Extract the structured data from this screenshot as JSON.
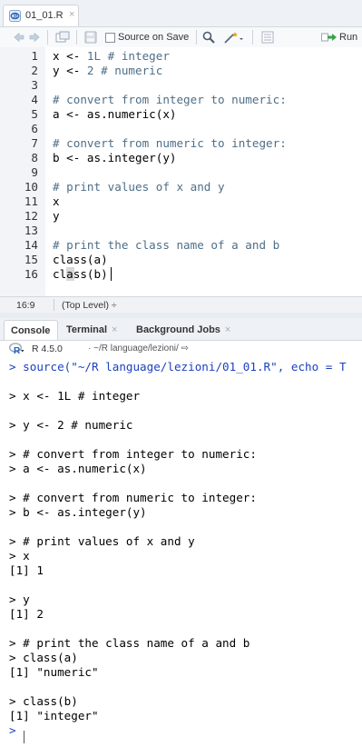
{
  "editor": {
    "tab_label": "01_01.R",
    "tab_close": "×",
    "source_on_save_label": "Source on Save",
    "run_label": "Run",
    "lines": [
      {
        "n": "1",
        "code": "x <- ",
        "num": "1L",
        "comment": " # integer"
      },
      {
        "n": "2",
        "code": "y <- ",
        "num": "2",
        "comment": " # numeric"
      },
      {
        "n": "3",
        "code": "",
        "num": "",
        "comment": ""
      },
      {
        "n": "4",
        "code": "",
        "num": "",
        "comment": "# convert from integer to numeric:"
      },
      {
        "n": "5",
        "code": "a <- as.numeric(x)",
        "num": "",
        "comment": ""
      },
      {
        "n": "6",
        "code": "",
        "num": "",
        "comment": ""
      },
      {
        "n": "7",
        "code": "",
        "num": "",
        "comment": "# convert from numeric to integer:"
      },
      {
        "n": "8",
        "code": "b <- as.integer(y)",
        "num": "",
        "comment": ""
      },
      {
        "n": "9",
        "code": "",
        "num": "",
        "comment": ""
      },
      {
        "n": "10",
        "code": "",
        "num": "",
        "comment": "# print values of x and y"
      },
      {
        "n": "11",
        "code": "x",
        "num": "",
        "comment": ""
      },
      {
        "n": "12",
        "code": "y",
        "num": "",
        "comment": ""
      },
      {
        "n": "13",
        "code": "",
        "num": "",
        "comment": ""
      },
      {
        "n": "14",
        "code": "",
        "num": "",
        "comment": "# print the class name of a and b"
      },
      {
        "n": "15",
        "code": "class(a)",
        "num": "",
        "comment": ""
      },
      {
        "n": "16",
        "code": "class(b)",
        "num": "",
        "comment": ""
      }
    ],
    "status_position": "16:9",
    "status_scope": "(Top Level) ÷"
  },
  "console": {
    "tabs": [
      {
        "label": "Console",
        "close": ""
      },
      {
        "label": "Terminal",
        "close": "×"
      },
      {
        "label": "Background Jobs",
        "close": "×"
      }
    ],
    "r_version": "R 4.5.0",
    "working_dir": "· ~/R language/lezioni/ ⇨",
    "output": [
      {
        "text": "> source(\"~/R language/lezioni/01_01.R\", echo = T",
        "style": "blue"
      },
      {
        "text": "",
        "style": ""
      },
      {
        "text": "> x <- 1L # integer",
        "style": ""
      },
      {
        "text": "",
        "style": ""
      },
      {
        "text": "> y <- 2 # numeric",
        "style": ""
      },
      {
        "text": "",
        "style": ""
      },
      {
        "text": "> # convert from integer to numeric:",
        "style": ""
      },
      {
        "text": "> a <- as.numeric(x)",
        "style": ""
      },
      {
        "text": "",
        "style": ""
      },
      {
        "text": "> # convert from numeric to integer:",
        "style": ""
      },
      {
        "text": "> b <- as.integer(y)",
        "style": ""
      },
      {
        "text": "",
        "style": ""
      },
      {
        "text": "> # print values of x and y",
        "style": ""
      },
      {
        "text": "> x",
        "style": ""
      },
      {
        "text": "[1] 1",
        "style": ""
      },
      {
        "text": "",
        "style": ""
      },
      {
        "text": "> y",
        "style": ""
      },
      {
        "text": "[1] 2",
        "style": ""
      },
      {
        "text": "",
        "style": ""
      },
      {
        "text": "> # print the class name of a and b",
        "style": ""
      },
      {
        "text": "> class(a)",
        "style": ""
      },
      {
        "text": "[1] \"numeric\"",
        "style": ""
      },
      {
        "text": "",
        "style": ""
      },
      {
        "text": "> class(b)",
        "style": ""
      },
      {
        "text": "[1] \"integer\"",
        "style": ""
      },
      {
        "text": ">",
        "style": "blue"
      }
    ]
  },
  "colors": {
    "comment": "#4d6e88",
    "prompt_blue": "#1b3fbf",
    "r_logo_blue": "#2264b8"
  },
  "icons": {
    "back": "arrow-left-icon",
    "forward": "arrow-right-icon",
    "show_in_window": "popout-icon",
    "save": "floppy-disk-icon",
    "find": "magnifier-icon",
    "code_tools": "magic-wand-icon",
    "outline": "outline-list-icon",
    "run": "run-arrow-icon"
  }
}
